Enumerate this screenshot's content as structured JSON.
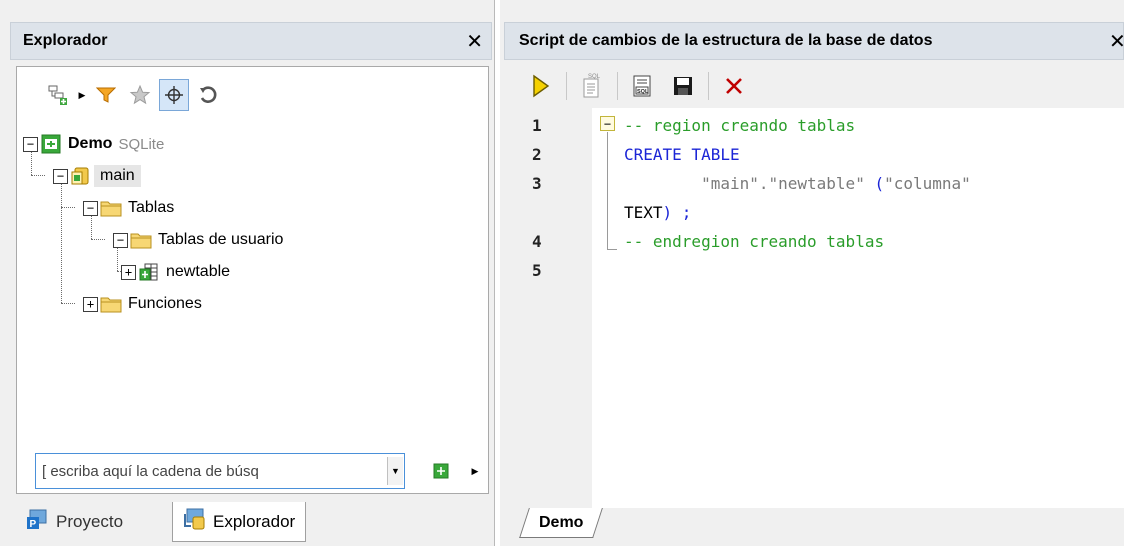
{
  "explorer": {
    "title": "Explorador",
    "close_label": "✕",
    "toolbar": {
      "icons": [
        "add-object-icon",
        "filter-icon",
        "favorites-icon",
        "locate-icon",
        "refresh-icon"
      ]
    },
    "tree": {
      "root": {
        "label": "Demo",
        "sub": "SQLite"
      },
      "schema": {
        "label": "main"
      },
      "tables": {
        "label": "Tablas"
      },
      "user_tables": {
        "label": "Tablas de usuario"
      },
      "table_item": {
        "label": "newtable"
      },
      "functions": {
        "label": "Funciones"
      }
    },
    "search": {
      "value": "[ escriba aquí la cadena de búsq"
    },
    "bottom_tabs": {
      "project": "Proyecto",
      "explorer": "Explorador"
    }
  },
  "script": {
    "title": "Script de cambios de la estructura de la base de datos",
    "close_label": "✕",
    "line_numbers": [
      "1",
      "2",
      "3",
      "",
      "4",
      "5"
    ],
    "code": {
      "line1": "-- region creando tablas",
      "line2": "CREATE TABLE",
      "line3_indent": "        ",
      "line3_table": "\"main\".\"newtable\"",
      "line3_paren": "(",
      "line3_col": "\"columna\"",
      "line3b_type": "TEXT",
      "line3b_end": ") ;",
      "line4": "-- endregion creando tablas"
    },
    "fold_symbol": "−",
    "doc_tab": "Demo"
  }
}
